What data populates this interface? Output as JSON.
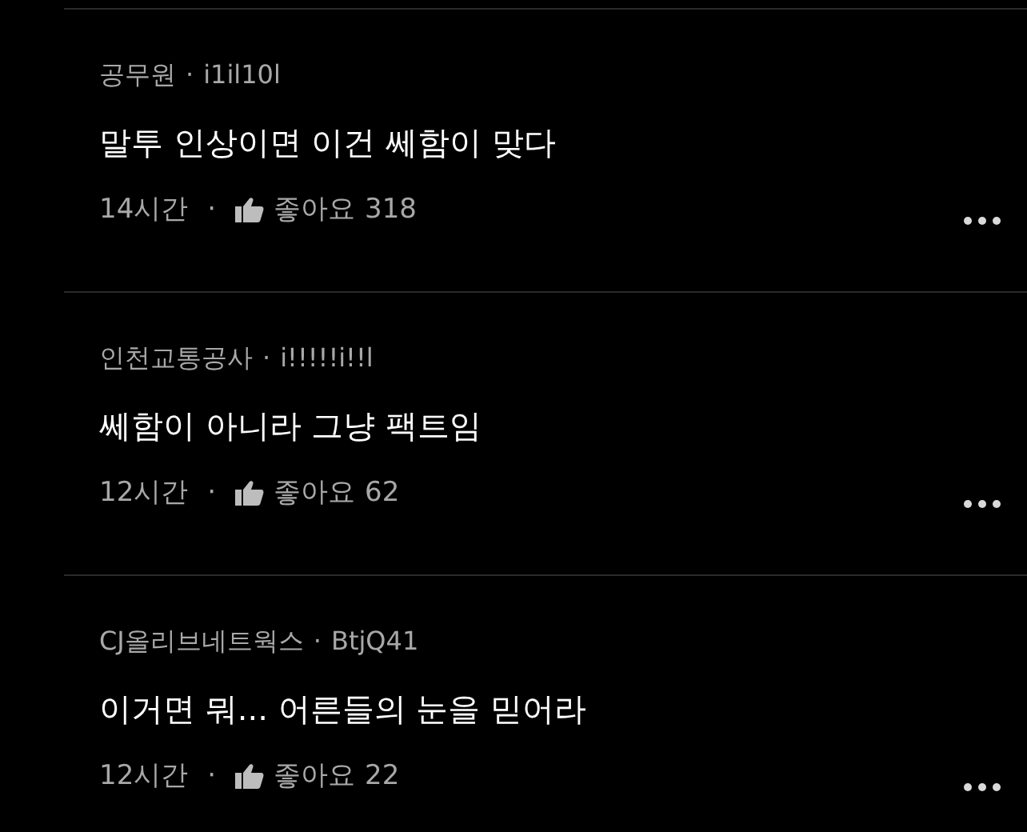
{
  "comments": [
    {
      "company": "공무원",
      "nickname": "i1il10l",
      "body": "말투 인상이면 이건 쎄함이 맞다",
      "time": "14시간",
      "separator": "·",
      "like_label": "좋아요",
      "like_count": "318"
    },
    {
      "company": "인천교통공사",
      "nickname": "i!!!!!i!!l",
      "body": "쎄함이 아니라 그냥 팩트임",
      "time": "12시간",
      "separator": "·",
      "like_label": "좋아요",
      "like_count": "62"
    },
    {
      "company": "CJ올리브네트웍스",
      "nickname": "BtjQ41",
      "body": "이거면 뭐... 어른들의 눈을 믿어라",
      "time": "12시간",
      "separator": "·",
      "like_label": "좋아요",
      "like_count": "22"
    }
  ]
}
